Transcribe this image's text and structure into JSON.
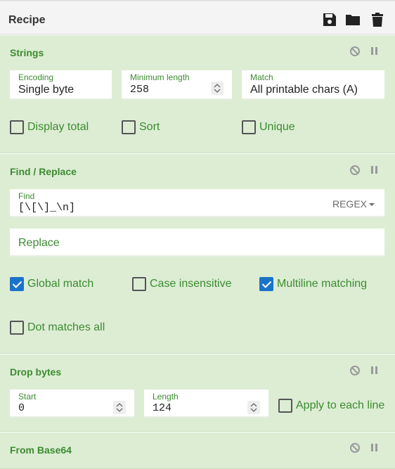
{
  "recipe": {
    "title": "Recipe"
  },
  "strings": {
    "title": "Strings",
    "encoding": {
      "label": "Encoding",
      "value": "Single byte"
    },
    "min_length": {
      "label": "Minimum length",
      "value": "258"
    },
    "match": {
      "label": "Match",
      "value": "All printable chars (A)"
    },
    "display_total": {
      "label": "Display total",
      "checked": false
    },
    "sort": {
      "label": "Sort",
      "checked": false
    },
    "unique": {
      "label": "Unique",
      "checked": false
    }
  },
  "find_replace": {
    "title": "Find / Replace",
    "find": {
      "label": "Find",
      "value": "[\\[\\]_\\n]"
    },
    "mode": "REGEX",
    "replace": {
      "placeholder": "Replace"
    },
    "global_match": {
      "label": "Global match",
      "checked": true
    },
    "case_insensitive": {
      "label": "Case insensitive",
      "checked": false
    },
    "multiline": {
      "label": "Multiline matching",
      "checked": true
    },
    "dot_all": {
      "label": "Dot matches all",
      "checked": false
    }
  },
  "drop_bytes": {
    "title": "Drop bytes",
    "start": {
      "label": "Start",
      "value": "0"
    },
    "length": {
      "label": "Length",
      "value": "124"
    },
    "apply_each_line": {
      "label": "Apply to each line",
      "checked": false
    }
  },
  "from_base64": {
    "title": "From Base64"
  },
  "colors": {
    "accent": "#3c8b30",
    "panel": "#dcedd4",
    "checkbox": "#1a73c9"
  }
}
